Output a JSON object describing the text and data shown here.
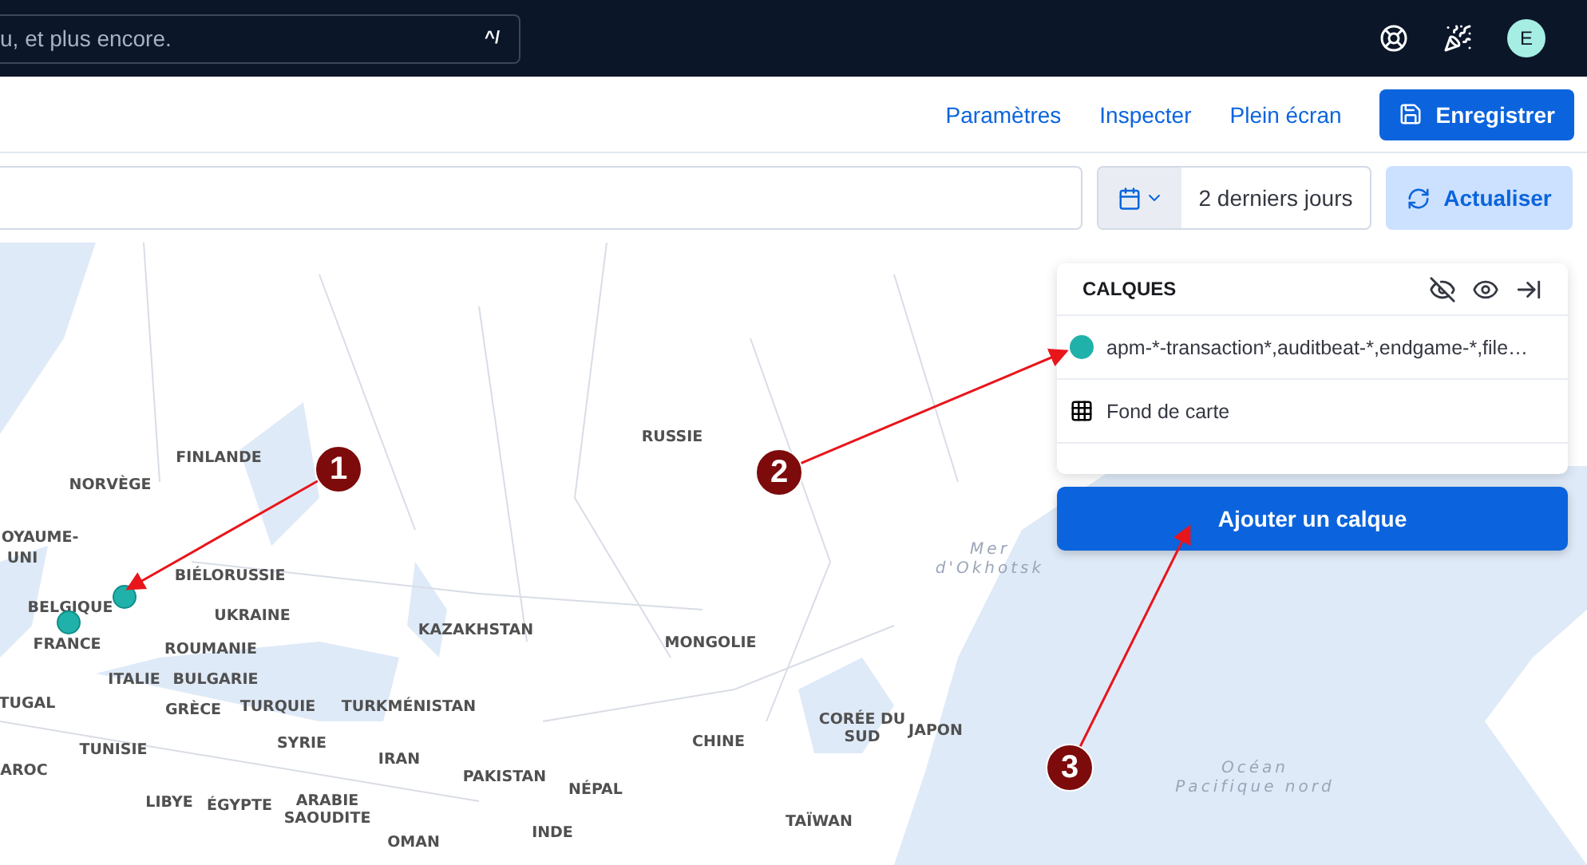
{
  "header": {
    "search": {
      "placeholder": "u, et plus encore.",
      "shortcut": "^/"
    },
    "avatar": "E"
  },
  "toolbar": {
    "links": [
      "Paramètres",
      "Inspecter",
      "Plein écran"
    ],
    "save_button": "Enregistrer"
  },
  "query_bar": {
    "date_range": "2 derniers jours",
    "refresh_button": "Actualiser"
  },
  "map": {
    "labels": [
      {
        "text": "FINLANDE",
        "kind": "country"
      },
      {
        "text": "NORVÈGE",
        "kind": "country"
      },
      {
        "text": "OYAUME-",
        "kind": "country"
      },
      {
        "text": "UNI",
        "kind": "country"
      },
      {
        "text": "BELGIQUE",
        "kind": "country"
      },
      {
        "text": "FRANCE",
        "kind": "country"
      },
      {
        "text": "BIÉLORUSSIE",
        "kind": "country"
      },
      {
        "text": "UKRAINE",
        "kind": "country"
      },
      {
        "text": "KAZAKHSTAN",
        "kind": "country"
      },
      {
        "text": "ROUMANIE",
        "kind": "country"
      },
      {
        "text": "ITALIE",
        "kind": "country"
      },
      {
        "text": "BULGARIE",
        "kind": "country"
      },
      {
        "text": "TUGAL",
        "kind": "country"
      },
      {
        "text": "GRÈCE",
        "kind": "country"
      },
      {
        "text": "TURQUIE",
        "kind": "country"
      },
      {
        "text": "TURKMÉNISTAN",
        "kind": "country"
      },
      {
        "text": "TUNISIE",
        "kind": "country"
      },
      {
        "text": "SYRIE",
        "kind": "country"
      },
      {
        "text": "IRAN",
        "kind": "country"
      },
      {
        "text": "AROC",
        "kind": "country"
      },
      {
        "text": "PAKISTAN",
        "kind": "country"
      },
      {
        "text": "LIBYE",
        "kind": "country"
      },
      {
        "text": "ÉGYPTE",
        "kind": "country"
      },
      {
        "text": "ARABIE SAOUDITE",
        "kind": "country"
      },
      {
        "text": "OMAN",
        "kind": "country"
      },
      {
        "text": "RUSSIE",
        "kind": "country"
      },
      {
        "text": "MONGOLIE",
        "kind": "country"
      },
      {
        "text": "CHINE",
        "kind": "country"
      },
      {
        "text": "CORÉE DU SUD",
        "kind": "country"
      },
      {
        "text": "JAPON",
        "kind": "country"
      },
      {
        "text": "NÉPAL",
        "kind": "country"
      },
      {
        "text": "INDE",
        "kind": "country"
      },
      {
        "text": "TAÏWAN",
        "kind": "country"
      },
      {
        "text": "Mer d'Okhotsk",
        "kind": "sea"
      },
      {
        "text": "Océan Pacifique nord",
        "kind": "sea"
      }
    ],
    "points": [
      {
        "color": "#20b2aa"
      },
      {
        "color": "#20b2aa"
      }
    ]
  },
  "layers_panel": {
    "title": "CALQUES",
    "layers": [
      {
        "name": "apm-*-transaction*,auditbeat-*,endgame-*,file…",
        "kind": "points",
        "color": "#20b2aa"
      },
      {
        "name": "Fond de carte",
        "kind": "basemap"
      }
    ],
    "add_button": "Ajouter un calque"
  },
  "annotations": [
    "1",
    "2",
    "3"
  ]
}
